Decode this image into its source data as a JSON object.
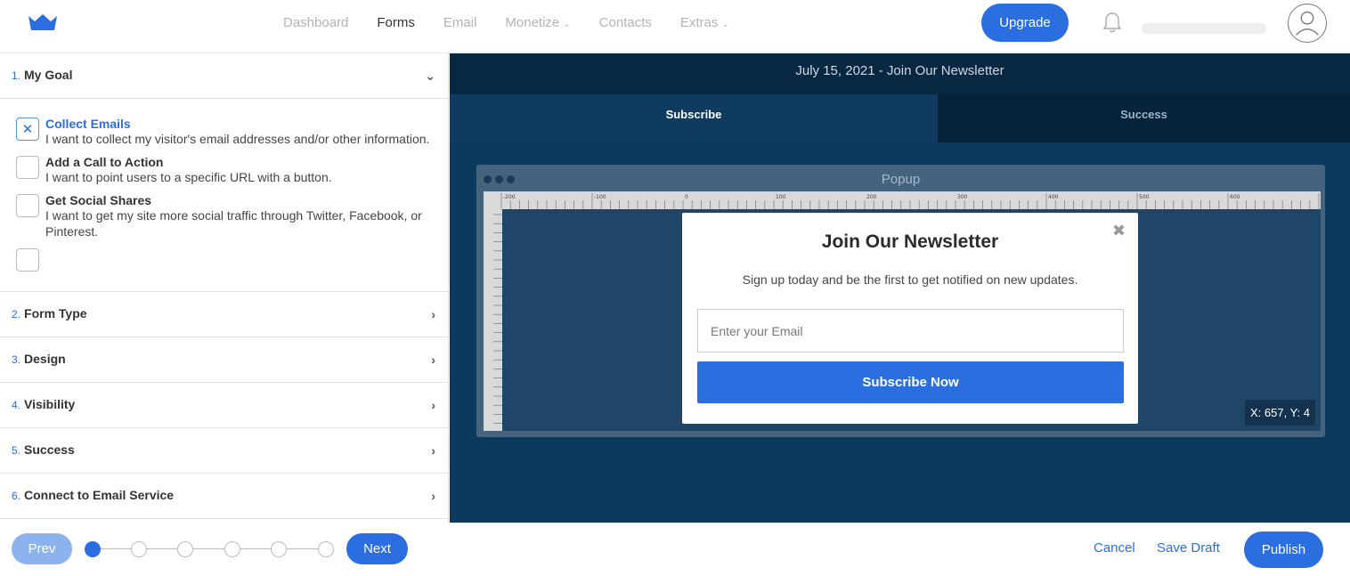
{
  "nav": {
    "items": [
      {
        "label": "Dashboard",
        "active": false,
        "dropdown": false
      },
      {
        "label": "Forms",
        "active": true,
        "dropdown": false
      },
      {
        "label": "Email",
        "active": false,
        "dropdown": false
      },
      {
        "label": "Monetize",
        "active": false,
        "dropdown": true
      },
      {
        "label": "Contacts",
        "active": false,
        "dropdown": false
      },
      {
        "label": "Extras",
        "active": false,
        "dropdown": true
      }
    ],
    "upgrade_label": "Upgrade"
  },
  "sidebar": {
    "sections": [
      {
        "num": "1.",
        "title": "My Goal",
        "expanded": true
      },
      {
        "num": "2.",
        "title": "Form Type",
        "expanded": false
      },
      {
        "num": "3.",
        "title": "Design",
        "expanded": false
      },
      {
        "num": "4.",
        "title": "Visibility",
        "expanded": false
      },
      {
        "num": "5.",
        "title": "Success",
        "expanded": false
      },
      {
        "num": "6.",
        "title": "Connect to Email Service",
        "expanded": false
      }
    ],
    "goals": [
      {
        "title": "Collect Emails",
        "desc": "I want to collect my visitor's email addresses and/or other information.",
        "checked": true
      },
      {
        "title": "Add a Call to Action",
        "desc": "I want to point users to a specific URL with a button.",
        "checked": false
      },
      {
        "title": "Get Social Shares",
        "desc": "I want to get my site more social traffic through Twitter, Facebook, or Pinterest.",
        "checked": false
      }
    ]
  },
  "preview": {
    "title": "July 15, 2021 - Join Our Newsletter",
    "tabs": [
      {
        "label": "Subscribe",
        "active": true
      },
      {
        "label": "Success",
        "active": false
      }
    ],
    "window_title": "Popup",
    "coords": "X: 657, Y: 4",
    "ruler_labels": [
      "-200",
      "-100",
      "0",
      "100",
      "200",
      "300",
      "400",
      "500",
      "600",
      "7("
    ]
  },
  "popup": {
    "close_symbol": "✖",
    "title": "Join Our Newsletter",
    "subtitle": "Sign up today and be the first to get notified on new updates.",
    "email_placeholder": "Enter your Email",
    "button_label": "Subscribe Now"
  },
  "footer": {
    "prev_label": "Prev",
    "next_label": "Next",
    "current_step": 1,
    "total_steps": 6,
    "cancel_label": "Cancel",
    "save_draft_label": "Save Draft",
    "publish_label": "Publish"
  },
  "colors": {
    "accent": "#2a6ee0",
    "preview_bg": "#0c3a5e",
    "preview_header": "#082740"
  }
}
